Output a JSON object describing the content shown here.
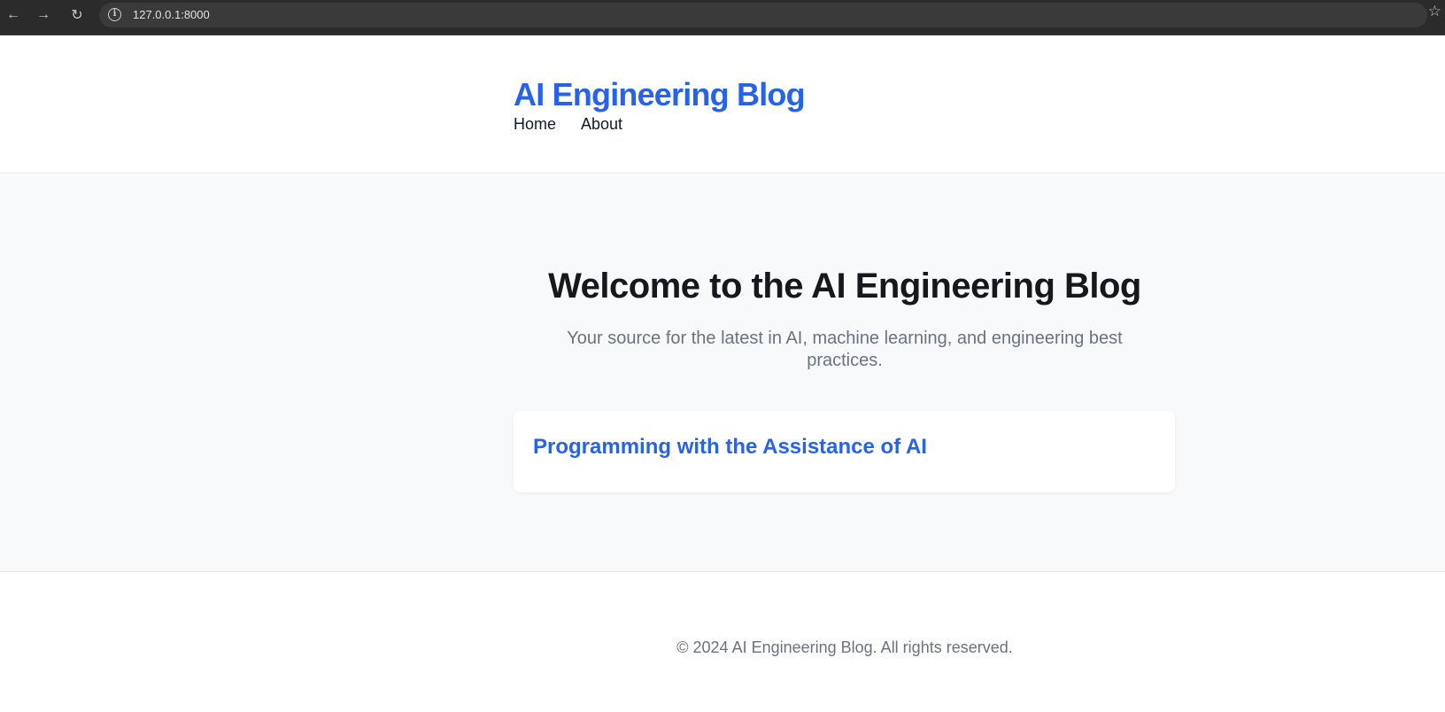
{
  "browser": {
    "url": "127.0.0.1:8000",
    "back_icon": "arrow-left-icon",
    "forward_icon": "arrow-right-icon",
    "reload_icon": "reload-icon",
    "info_icon": "info-icon",
    "bookmark_icon": "star-icon"
  },
  "header": {
    "site_title": "AI Engineering Blog",
    "nav": {
      "home": "Home",
      "about": "About"
    }
  },
  "hero": {
    "title": "Welcome to the AI Engineering Blog",
    "subtitle": "Your source for the latest in AI, machine learning, and engineering best practices."
  },
  "posts": [
    {
      "title": "Programming with the Assistance of AI"
    }
  ],
  "footer": {
    "copyright": "© 2024 AI Engineering Blog. All rights reserved."
  },
  "colors": {
    "accent": "#2563eb",
    "main_background": "#f8f9fb",
    "muted_text": "#6b7280",
    "browser_bar": "#2b2b2b"
  }
}
